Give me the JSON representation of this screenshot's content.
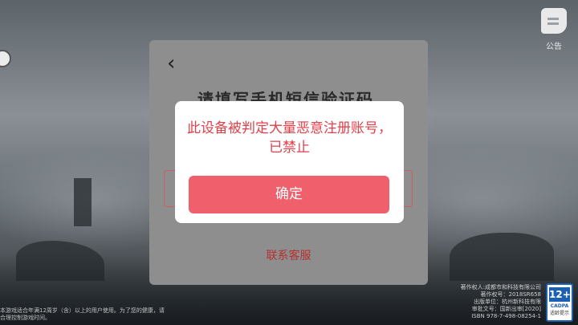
{
  "top_right": {
    "notice_label": "公告"
  },
  "panel": {
    "back_glyph": "‹",
    "title": "请填写手机短信验证码",
    "contact_link": "联系客服"
  },
  "dialog": {
    "message": "此设备被判定大量恶意注册账号，已禁止",
    "confirm_label": "确定"
  },
  "footer": {
    "left_tip": "本游戏适合年满12周岁（含）以上的用户使用。为了您的健康，请合理控制游戏时间。",
    "copyright_lines": [
      "著作权人:成都市和科技有限公司",
      "著作权号：2018SR658",
      "出版单位：杭州新科技有限",
      "审批文号：国新出审[2020]",
      "ISBN 978-7-498-08254-1"
    ]
  },
  "age_badge": {
    "age": "12+",
    "org": "CADPA",
    "tip": "适龄提示"
  }
}
